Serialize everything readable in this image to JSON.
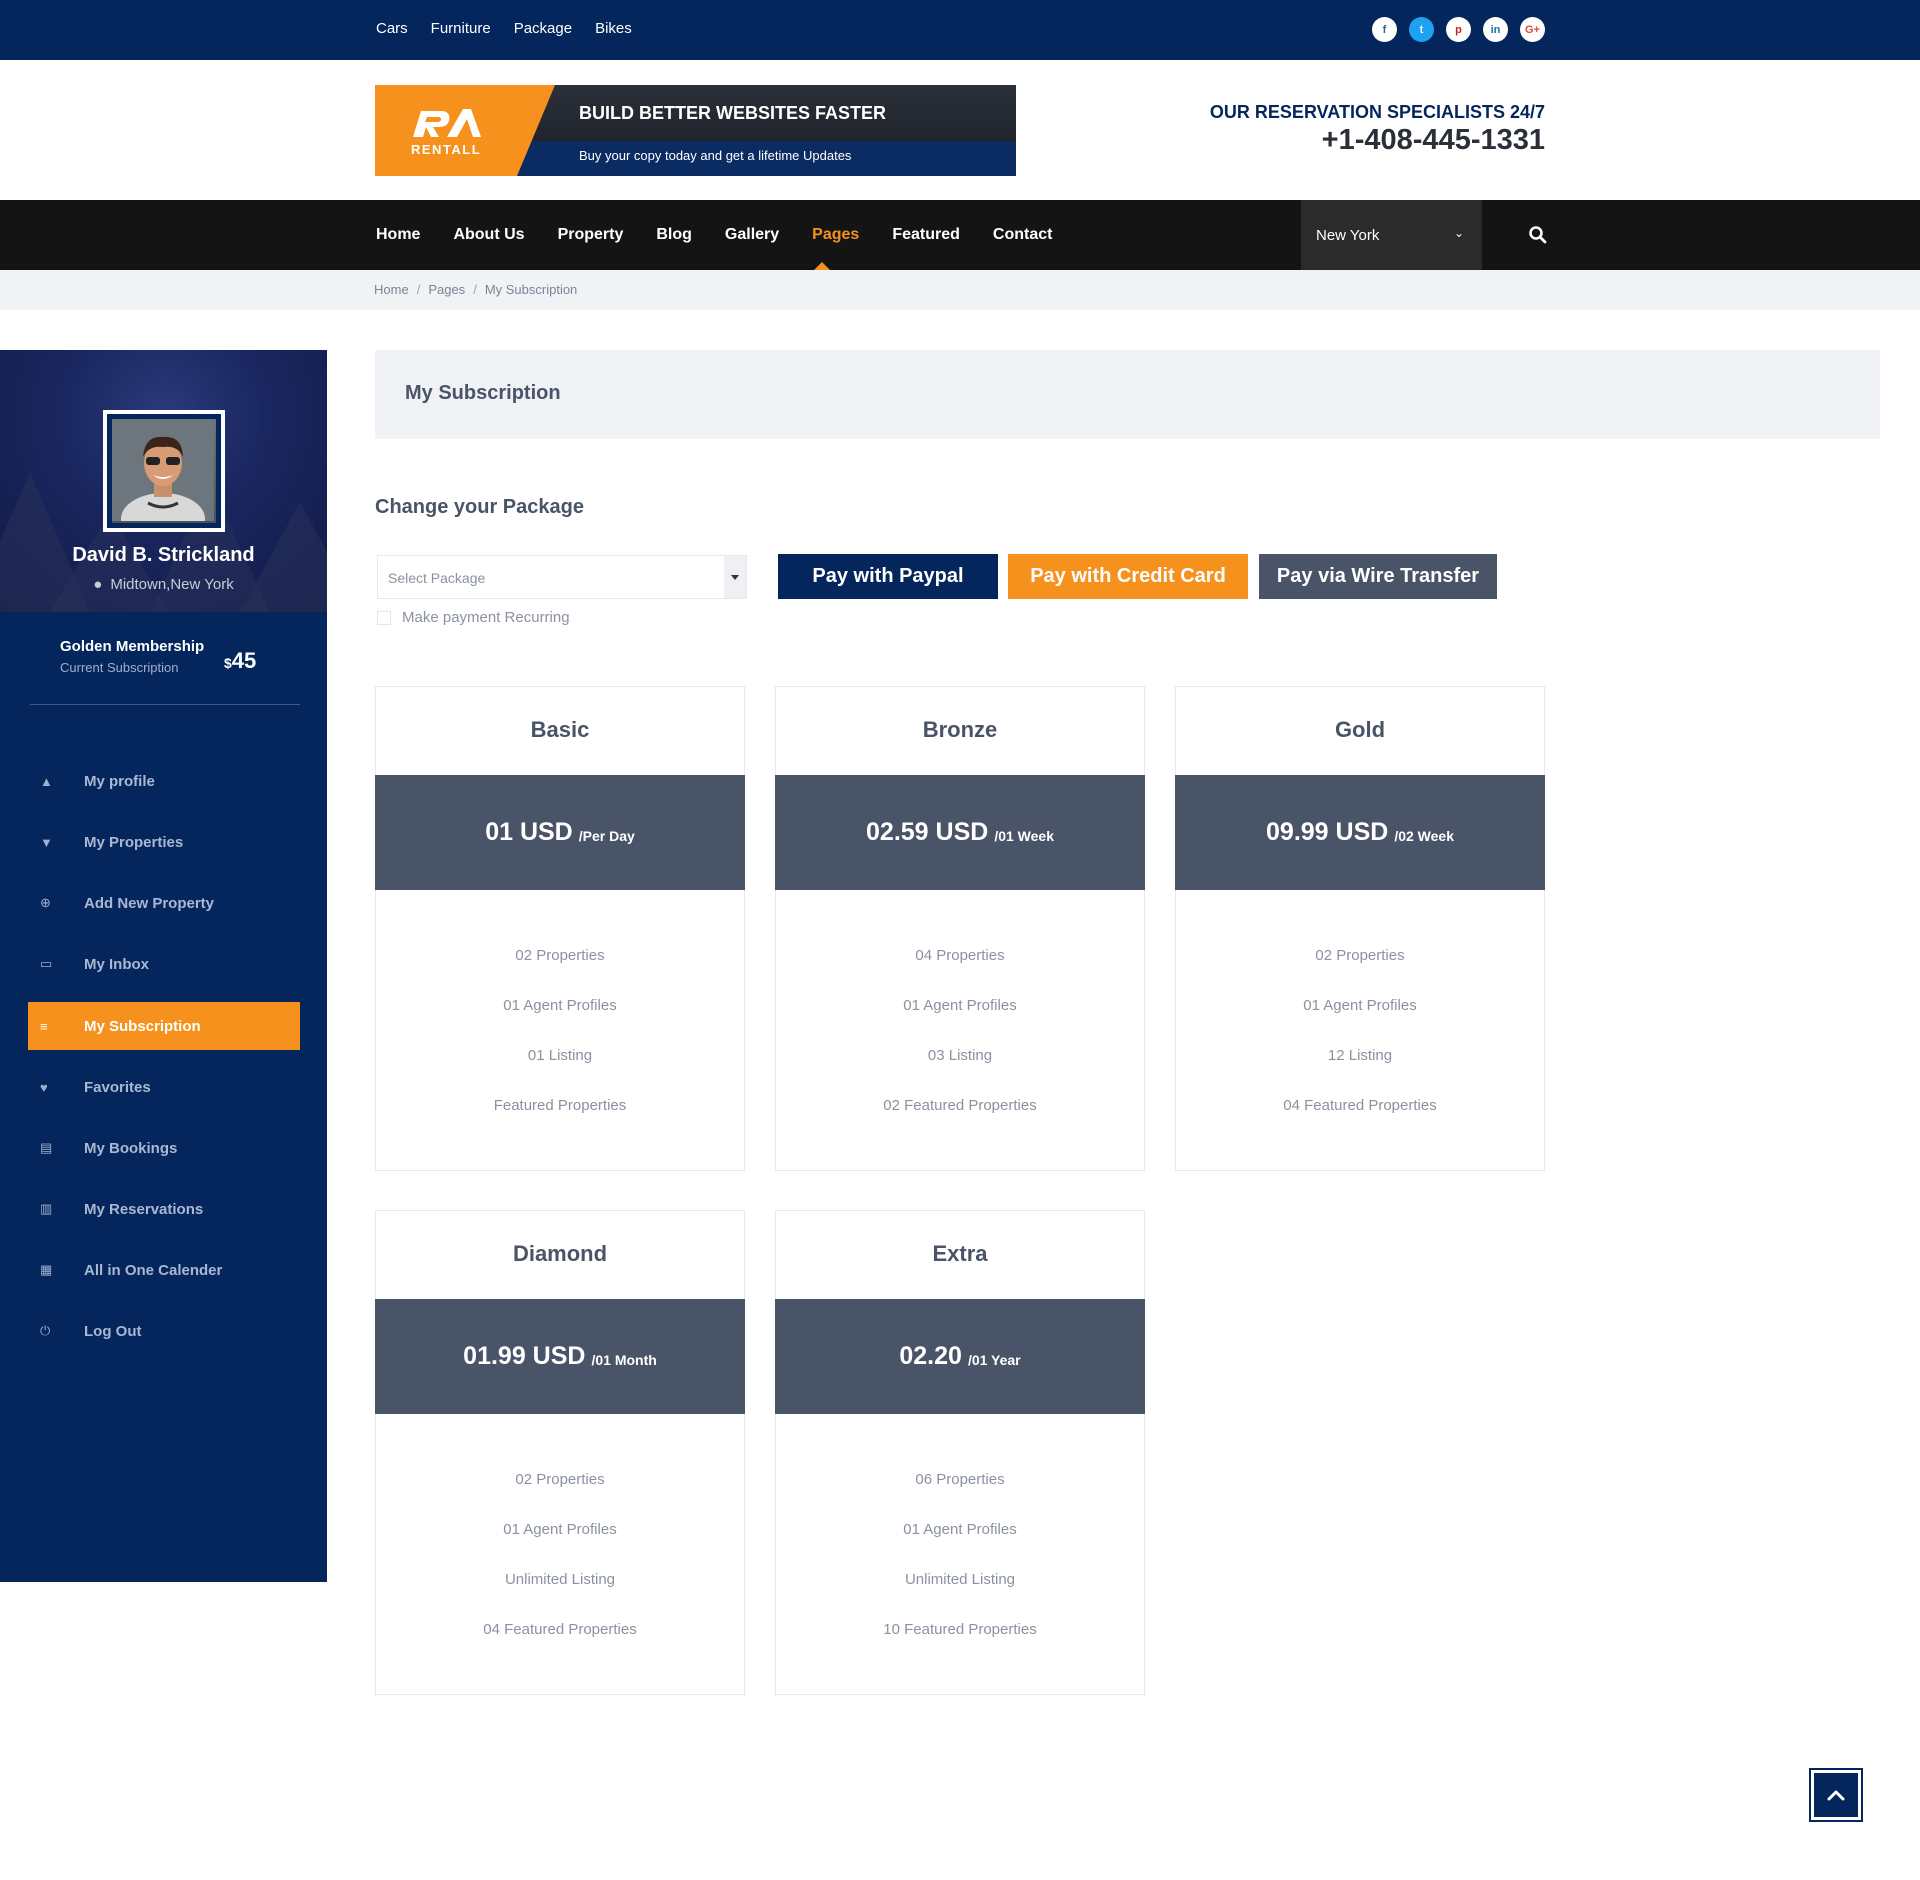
{
  "topbar": {
    "links": [
      "Cars",
      "Furniture",
      "Package",
      "Bikes"
    ],
    "socials": [
      {
        "icon": "facebook-icon",
        "glyph": "f",
        "color": "#3b5998"
      },
      {
        "icon": "twitter-icon",
        "glyph": "t",
        "color": "#1da1f2"
      },
      {
        "icon": "pinterest-icon",
        "glyph": "p",
        "color": "#cb2027"
      },
      {
        "icon": "linkedin-icon",
        "glyph": "in",
        "color": "#0e76a8"
      },
      {
        "icon": "google-plus-icon",
        "glyph": "G+",
        "color": "#dd4b39"
      }
    ]
  },
  "banner": {
    "logo_text": "RENTALL",
    "title": "BUILD BETTER WEBSITES FASTER",
    "subtitle": "Buy your copy today and get a lifetime Updates"
  },
  "reservation": {
    "title": "OUR RESERVATION SPECIALISTS 24/7",
    "phone": "+1-408-445-1331"
  },
  "nav": {
    "items": [
      "Home",
      "About Us",
      "Property",
      "Blog",
      "Gallery",
      "Pages",
      "Featured",
      "Contact"
    ],
    "active": "Pages",
    "city": "New York",
    "search_icon": "search-icon"
  },
  "breadcrumb": [
    "Home",
    "Pages",
    "My Subscription"
  ],
  "profile": {
    "name": "David B. Strickland",
    "location": "Midtown,New York",
    "membership_title": "Golden Membership",
    "membership_sub": "Current Subscription",
    "price_currency": "$",
    "price_value": "45"
  },
  "sidebar": {
    "items": [
      {
        "label": "My profile",
        "icon": "user-icon",
        "glyph": "▲"
      },
      {
        "label": "My Properties",
        "icon": "map-marker-icon",
        "glyph": "▼"
      },
      {
        "label": "Add New Property",
        "icon": "plus-circle-icon",
        "glyph": "⊕"
      },
      {
        "label": "My Inbox",
        "icon": "inbox-icon",
        "glyph": "▭"
      },
      {
        "label": "My Subscription",
        "icon": "list-icon",
        "glyph": "≡",
        "active": true
      },
      {
        "label": "Favorites",
        "icon": "heart-icon",
        "glyph": "♥"
      },
      {
        "label": "My Bookings",
        "icon": "folder-open-icon",
        "glyph": "▤"
      },
      {
        "label": "My Reservations",
        "icon": "folder-open-filled-icon",
        "glyph": "▥"
      },
      {
        "label": "All in One Calender",
        "icon": "calendar-icon",
        "glyph": "▦"
      },
      {
        "label": "Log Out",
        "icon": "power-icon",
        "glyph": "⏻"
      }
    ]
  },
  "main": {
    "page_title": "My Subscription",
    "change_title": "Change your Package",
    "select_placeholder": "Select Package",
    "recurring_label": "Make payment Recurring",
    "buttons": {
      "paypal": "Pay with Paypal",
      "credit": "Pay with Credit Card",
      "wire": "Pay via Wire Transfer"
    }
  },
  "plans": [
    {
      "name": "Basic",
      "price": "01 USD",
      "period": "/Per Day",
      "features": [
        "02 Properties",
        "01 Agent Profiles",
        "01 Listing",
        "Featured Properties"
      ]
    },
    {
      "name": "Bronze",
      "price": "02.59 USD",
      "period": "/01 Week",
      "features": [
        "04 Properties",
        "01 Agent Profiles",
        "03 Listing",
        "02 Featured Properties"
      ]
    },
    {
      "name": "Gold",
      "price": "09.99 USD",
      "period": "/02 Week",
      "features": [
        "02 Properties",
        "01 Agent Profiles",
        "12 Listing",
        "04 Featured Properties"
      ]
    },
    {
      "name": "Diamond",
      "price": "01.99 USD",
      "period": "/01 Month",
      "features": [
        "02 Properties",
        "01 Agent Profiles",
        "Unlimited Listing",
        "04 Featured Properties"
      ]
    },
    {
      "name": "Extra",
      "price": "02.20",
      "period": "/01 Year",
      "features": [
        "06 Properties",
        "01 Agent Profiles",
        "Unlimited Listing",
        "10 Featured Properties"
      ]
    }
  ],
  "colors": {
    "navy": "#04265c",
    "orange": "#f7911d",
    "slate": "#4a5468"
  }
}
